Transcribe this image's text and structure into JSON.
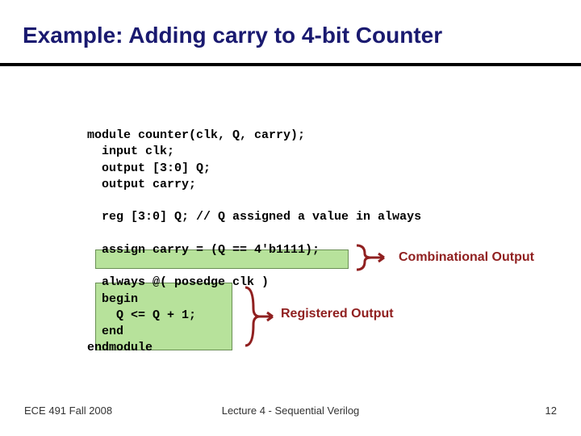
{
  "title": "Example: Adding carry to 4-bit Counter",
  "code": "module counter(clk, Q, carry);\n  input clk;\n  output [3:0] Q;\n  output carry;\n\n  reg [3:0] Q; // Q assigned a value in always\n\n  assign carry = (Q == 4'b1111);\n\n  always @( posedge clk )\n  begin\n    Q <= Q + 1;\n  end\nendmodule",
  "annotation1": "Combinational Output",
  "annotation2": "Registered Output",
  "footer": {
    "left": "ECE 491 Fall 2008",
    "center": "Lecture 4 - Sequential Verilog",
    "right": "12"
  }
}
